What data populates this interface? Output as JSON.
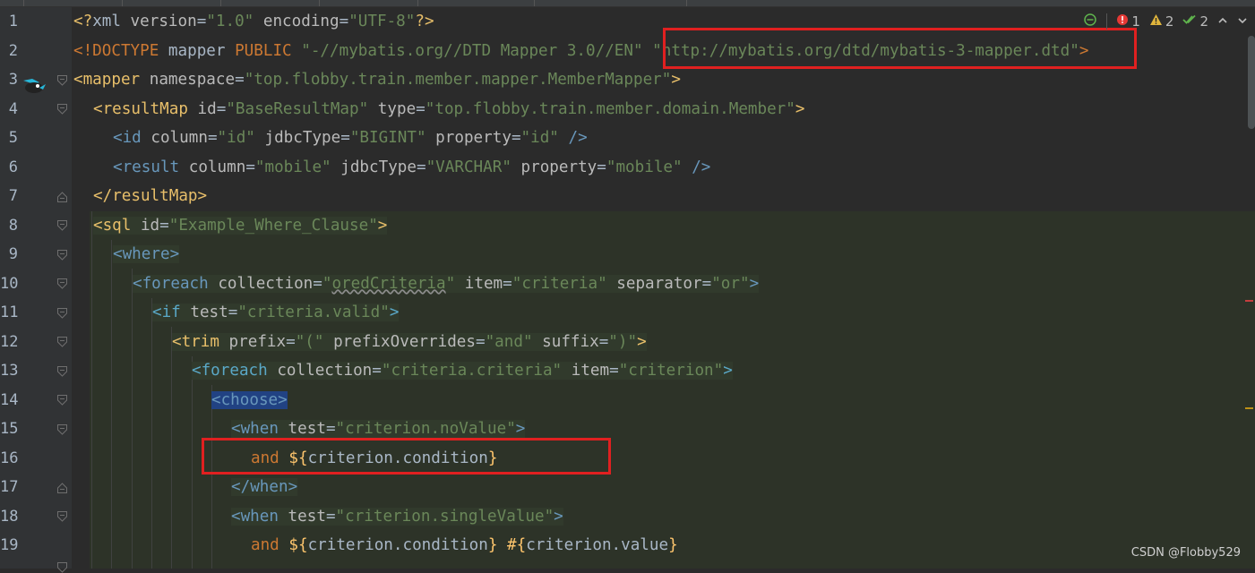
{
  "line_numbers": [
    "1",
    "2",
    "3",
    "4",
    "5",
    "6",
    "7",
    "8",
    "9",
    "10",
    "11",
    "12",
    "13",
    "14",
    "15",
    "16",
    "17",
    "18",
    "19"
  ],
  "status": {
    "errors": "1",
    "warnings": "2",
    "weak_warnings": "2"
  },
  "code": {
    "l1": {
      "a": "<?",
      "b": "xml",
      "c": " version",
      "d": "=",
      "e": "\"1.0\"",
      "f": " encoding",
      "g": "=",
      "h": "\"UTF-8\"",
      "i": "?>"
    },
    "l2": {
      "a": "<!DOCTYPE",
      "b": " mapper ",
      "c": "PUBLIC",
      "d": " \"-//mybatis.org//DTD Mapper 3.0//EN\"",
      "e": " \"http://mybatis.org/dtd/mybatis-3-mapper.dtd\"",
      "f": ">"
    },
    "l3": {
      "a": "<",
      "b": "mapper",
      "c": " namespace",
      "d": "=",
      "e": "\"top.flobby.train.member.mapper.MemberMapper\"",
      "f": ">"
    },
    "l4": {
      "a": "<",
      "b": "resultMap",
      "c": " id",
      "d": "=",
      "e": "\"BaseResultMap\"",
      "f": " type",
      "g": "=",
      "h": "\"top.flobby.train.member.domain.Member\"",
      "i": ">"
    },
    "l5": {
      "a": "<",
      "b": "id",
      "c": " column",
      "d": "=",
      "e": "\"id\"",
      "f": " jdbcType",
      "g": "=",
      "h": "\"BIGINT\"",
      "i": " property",
      "j": "=",
      "k": "\"id\"",
      "l": " />"
    },
    "l6": {
      "a": "<",
      "b": "result",
      "c": " column",
      "d": "=",
      "e": "\"mobile\"",
      "f": " jdbcType",
      "g": "=",
      "h": "\"VARCHAR\"",
      "i": " property",
      "j": "=",
      "k": "\"mobile\"",
      "l": " />"
    },
    "l7": {
      "a": "</",
      "b": "resultMap",
      "c": ">"
    },
    "l8": {
      "a": "<",
      "b": "sql",
      "c": " id",
      "d": "=",
      "e": "\"Example_Where_Clause\"",
      "f": ">"
    },
    "l9": {
      "a": "<",
      "b": "where",
      "c": ">"
    },
    "l10": {
      "a": "<",
      "b": "foreach",
      "c": " collection",
      "d": "=",
      "e1": "\"",
      "e2": "oredCriteria",
      "e3": "\"",
      "f": " item",
      "g": "=",
      "h": "\"criteria\"",
      "i": " separator",
      "j": "=",
      "k": "\"or\"",
      "l": ">"
    },
    "l11": {
      "a": "<",
      "b": "if",
      "c": " test",
      "d": "=",
      "e": "\"criteria.valid\"",
      "f": ">"
    },
    "l12": {
      "a": "<",
      "b": "trim",
      "c": " prefix",
      "d": "=",
      "e": "\"(\"",
      "f": " prefixOverrides",
      "g": "=",
      "h": "\"and\"",
      "i": " suffix",
      "j": "=",
      "k": "\")\"",
      "l": ">"
    },
    "l13": {
      "a": "<",
      "b": "foreach",
      "c": " collection",
      "d": "=",
      "e": "\"criteria.criteria\"",
      "f": " item",
      "g": "=",
      "h": "\"criterion\"",
      "i": ">"
    },
    "l14": {
      "a": "<",
      "b": "choose",
      "c": ">"
    },
    "l15": {
      "a": "<",
      "b": "when",
      "c": " test",
      "d": "=",
      "e": "\"criterion.noValue\"",
      "f": ">"
    },
    "l16": {
      "a": "and ",
      "b": "${",
      "c": "criterion.condition",
      "d": "}"
    },
    "l17": {
      "a": "</",
      "b": "when",
      "c": ">"
    },
    "l18": {
      "a": "<",
      "b": "when",
      "c": " test",
      "d": "=",
      "e": "\"criterion.singleValue\"",
      "f": ">"
    },
    "l19": {
      "a": "and ",
      "b": "${",
      "c": "criterion.condition",
      "d": "}",
      "e": " #{",
      "f": "criterion.value",
      "g": "}"
    }
  },
  "watermark": "CSDN @Flobby529",
  "colors": {
    "tag_yellow": "#e8bf6a",
    "tag_blue": "#6897bb",
    "string_green": "#6a8759",
    "keyword_orange": "#cc7832",
    "highlight_red": "#e02020"
  }
}
